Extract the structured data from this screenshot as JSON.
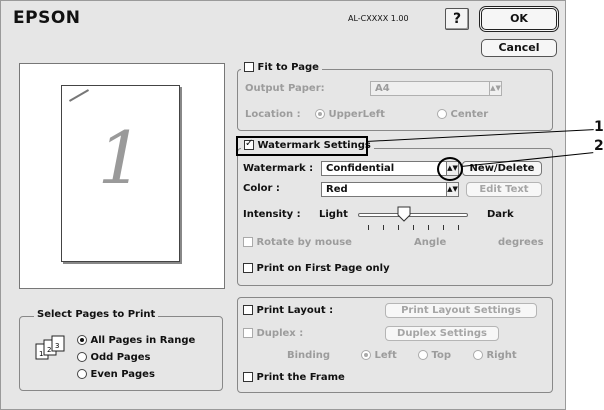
{
  "header": {
    "brand": "EPSON",
    "model": "AL-CXXXX 1.00",
    "help_label": "?",
    "ok_label": "OK",
    "cancel_label": "Cancel"
  },
  "preview": {
    "page_number": "1"
  },
  "select_pages": {
    "title": "Select Pages to Print",
    "options": [
      "All Pages in Range",
      "Odd Pages",
      "Even Pages"
    ],
    "selected": "All Pages in Range"
  },
  "fit_to_page": {
    "label": "Fit to Page",
    "checked": false,
    "output_paper_label": "Output Paper:",
    "output_paper_value": "A4",
    "location_label": "Location :",
    "location_options": [
      "UpperLeft",
      "Center"
    ],
    "location_selected": "UpperLeft"
  },
  "watermark": {
    "settings_label": "Watermark Settings",
    "checked": true,
    "watermark_label": "Watermark :",
    "watermark_value": "Confidential",
    "new_delete_label": "New/Delete",
    "color_label": "Color :",
    "color_value": "Red",
    "edit_text_label": "Edit Text",
    "intensity_label": "Intensity :",
    "intensity_low": "Light",
    "intensity_high": "Dark",
    "intensity_level": 0.5,
    "rotate_label": "Rotate by mouse",
    "angle_label": "Angle",
    "degrees_label": "degrees",
    "first_page_label": "Print on First Page only",
    "first_page_checked": false
  },
  "layout": {
    "print_layout_label": "Print Layout :",
    "print_layout_settings_label": "Print Layout Settings",
    "duplex_label": "Duplex :",
    "duplex_settings_label": "Duplex Settings",
    "binding_label": "Binding",
    "binding_options": [
      "Left",
      "Top",
      "Right"
    ],
    "binding_selected": "Left",
    "print_frame_label": "Print the Frame"
  },
  "callouts": [
    "1",
    "2"
  ]
}
